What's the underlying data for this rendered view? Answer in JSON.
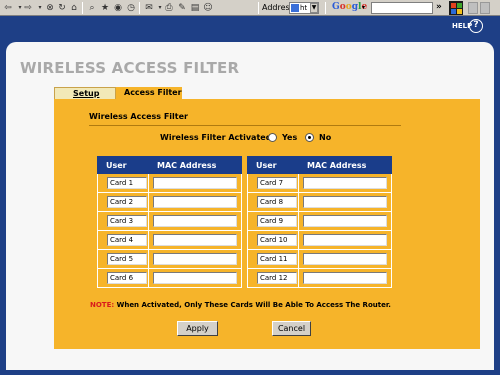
{
  "browser": {
    "address_label": "Address",
    "address_value": "ht",
    "google_label": "Google",
    "overflow_chevron": "»",
    "toolbar_icons": [
      "back-icon",
      "forward-icon",
      "stop-icon",
      "refresh-icon",
      "home-icon",
      "search-icon",
      "favorites-icon",
      "history-icon",
      "mail-icon",
      "print-icon",
      "edit-icon",
      "discuss-icon",
      "messenger-icon"
    ]
  },
  "header": {
    "help_label": "HELP",
    "help_icon": "?"
  },
  "page": {
    "title": "WIRELESS ACCESS FILTER",
    "tabs": [
      {
        "label": "Setup",
        "active": false
      },
      {
        "label": "Access Filter",
        "active": true
      }
    ],
    "section_title": "Wireless Access Filter",
    "activated": {
      "label": "Wireless Filter Activated",
      "options": [
        "Yes",
        "No"
      ],
      "selected": "No"
    },
    "table_headers": {
      "user": "User",
      "mac": "MAC Address"
    },
    "left_cards": [
      "Card 1",
      "Card 2",
      "Card 3",
      "Card 4",
      "Card 5",
      "Card 6"
    ],
    "right_cards": [
      "Card 7",
      "Card 8",
      "Card 9",
      "Card 10",
      "Card 11",
      "Card 12"
    ],
    "note_prefix": "NOTE:",
    "note_text": "When Activated, Only These Cards Will Be Able To Access The Router.",
    "apply_label": "Apply",
    "cancel_label": "Cancel"
  },
  "colors": {
    "header_blue": "#1e3f86",
    "panel_orange": "#f6b42a",
    "table_head_blue": "#1a3d8a",
    "note_red": "#d81c1c",
    "title_gray": "#a9a9a9"
  }
}
